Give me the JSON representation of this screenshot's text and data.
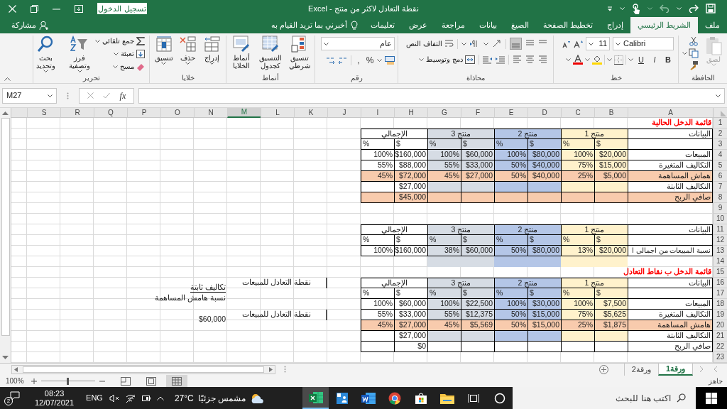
{
  "title_bar": {
    "title": "نقطة التعادل لاكثر من منتج  -  Excel",
    "sign_in": "تسجيل الدخول"
  },
  "ribbon_tabs": [
    {
      "label": "ملف",
      "selected": false
    },
    {
      "label": "الشريط الرئيسي",
      "selected": true
    },
    {
      "label": "إدراج",
      "selected": false
    },
    {
      "label": "تخطيط الصفحة",
      "selected": false
    },
    {
      "label": "الصيغ",
      "selected": false
    },
    {
      "label": "بيانات",
      "selected": false
    },
    {
      "label": "مراجعة",
      "selected": false
    },
    {
      "label": "عرض",
      "selected": false
    },
    {
      "label": "تعليمات",
      "selected": false
    }
  ],
  "tell_me": "أخبرني بما تريد القيام به",
  "share": "مشاركة",
  "ribbon": {
    "clipboard": {
      "label": "الحافظة",
      "paste": "لصق",
      "paste_disabled": true
    },
    "font": {
      "label": "خط",
      "name": "Calibri",
      "size": "11",
      "styles": [
        "B",
        "I",
        "U"
      ]
    },
    "alignment": {
      "label": "محاذاة",
      "wrap": "التفاف النص",
      "merge": "دمج وتوسيط"
    },
    "number": {
      "label": "رقم",
      "format": "عام",
      "symbols": [
        "%",
        ","
      ]
    },
    "styles": {
      "label": "أنماط",
      "buttons": [
        "تنسيق شرطي",
        "التنسيق كجدول",
        "أنماط الخلايا"
      ]
    },
    "cells": {
      "label": "خلايا",
      "buttons": [
        "إدراج",
        "حذف",
        "تنسيق"
      ]
    },
    "editing": {
      "label": "تحرير",
      "small": [
        "جمع تلقائي",
        "تعبئة",
        "مسح"
      ],
      "large": [
        "فرز وتصفية",
        "بحث وتحديد"
      ]
    }
  },
  "formula_bar": {
    "name_box": "M27",
    "function_label": "fx"
  },
  "columns": [
    {
      "label": "A",
      "selected": false
    },
    {
      "label": "B",
      "selected": false
    },
    {
      "label": "C",
      "selected": false
    },
    {
      "label": "D",
      "selected": false
    },
    {
      "label": "E",
      "selected": false
    },
    {
      "label": "F",
      "selected": false
    },
    {
      "label": "G",
      "selected": false
    },
    {
      "label": "H",
      "selected": false
    },
    {
      "label": "I",
      "selected": false
    },
    {
      "label": "J",
      "selected": false
    },
    {
      "label": "K",
      "selected": false
    },
    {
      "label": "L",
      "selected": false
    },
    {
      "label": "M",
      "selected": true
    },
    {
      "label": "N",
      "selected": false
    },
    {
      "label": "O",
      "selected": false
    },
    {
      "label": "P",
      "selected": false
    },
    {
      "label": "Q",
      "selected": false
    },
    {
      "label": "R",
      "selected": false
    },
    {
      "label": "S",
      "selected": false
    }
  ],
  "row_numbers": [
    "1",
    "2",
    "3",
    "4",
    "5",
    "6",
    "7",
    "8",
    "9",
    "10",
    "11",
    "12",
    "13",
    "14",
    "15",
    "16",
    "17",
    "18",
    "19",
    "20",
    "21",
    "22",
    "23"
  ],
  "tables": [
    {
      "title": "قائمة الدخل الحالية",
      "header_label": "البيانات",
      "groups": [
        {
          "label": "منتج 1",
          "color": "#fff2cc"
        },
        {
          "label": "منتج 2",
          "color": "#b4c6e7"
        },
        {
          "label": "منتج 3",
          "color": "#d6dce4"
        },
        {
          "label": "الإجمالي",
          "color": "#ffffff"
        }
      ],
      "units": [
        "$",
        "%",
        "$",
        "%",
        "$",
        "%",
        "$",
        "%"
      ],
      "rows": [
        {
          "label": "المبيعات",
          "kind": "groups",
          "values": [
            "$20,000",
            "100%",
            "$80,000",
            "100%",
            "$60,000",
            "100%",
            "$160,000",
            "100%"
          ]
        },
        {
          "label": "التكاليف المتغيرة",
          "kind": "groups",
          "values": [
            "$15,000",
            "75%",
            "$40,000",
            "50%",
            "$33,000",
            "55%",
            "$88,000",
            "55%"
          ]
        },
        {
          "label": "هماش المساهمة",
          "kind": "highlight",
          "values": [
            "$5,000",
            "25%",
            "$40,000",
            "50%",
            "$27,000",
            "45%",
            "$72,000",
            "45%"
          ]
        },
        {
          "label": "التكاليف الثابتة",
          "kind": "groups",
          "total": "$27,000"
        },
        {
          "label": "صافي الربح",
          "kind": "highlight",
          "total": "$45,000"
        }
      ]
    },
    {
      "header_label": "البيانات",
      "band": true,
      "groups": [
        {
          "label": "منتج 1",
          "color": "#fff2cc"
        },
        {
          "label": "منتج 2",
          "color": "#b4c6e7"
        },
        {
          "label": "منتج 3",
          "color": "#d6dce4"
        },
        {
          "label": "الإجمالي",
          "color": "#ffffff"
        }
      ],
      "units": [
        "$",
        "%",
        "$",
        "%",
        "$",
        "%",
        "$",
        "%"
      ],
      "rows": [
        {
          "label": "نسبة المبيعات من اجمالي ا",
          "kind": "groups",
          "values": [
            "$20,000",
            "13%",
            "$80,000",
            "50%",
            "$60,000",
            "38%",
            "$160,000",
            "100%"
          ]
        }
      ]
    },
    {
      "title": "قائمة الدخل ب نقاط التعادل",
      "header_label": "البيانات",
      "groups": [
        {
          "label": "منتج 1",
          "color": "#fff2cc"
        },
        {
          "label": "منتج 2",
          "color": "#b4c6e7"
        },
        {
          "label": "منتج 3",
          "color": "#d6dce4"
        },
        {
          "label": "الإجمالي",
          "color": "#ffffff"
        }
      ],
      "units": [
        "$",
        "%",
        "$",
        "%",
        "$",
        "%",
        "$",
        "%"
      ],
      "rows": [
        {
          "label": "المبيعات",
          "kind": "groups",
          "values": [
            "$7,500",
            "100%",
            "$30,000",
            "100%",
            "$22,500",
            "100%",
            "$60,000",
            "100%"
          ]
        },
        {
          "label": "التكاليف المتغيرة",
          "kind": "groups",
          "values": [
            "$5,625",
            "75%",
            "$15,000",
            "50%",
            "$12,375",
            "55%",
            "$33,000",
            "55%"
          ]
        },
        {
          "label": "هامش المساهمة",
          "kind": "highlight",
          "values": [
            "$1,875",
            "25%",
            "$15,000",
            "50%",
            "$5,569",
            "45%",
            "$27,000",
            "45%"
          ]
        },
        {
          "label": "التكاليف الثابتة",
          "kind": "groups",
          "total": "$27,000"
        },
        {
          "label": "صافي الربح",
          "kind": "plain",
          "total": "$0"
        }
      ],
      "notes": [
        {
          "label": "نقطة التعادل للمبيعات",
          "value": "تكاليف ثابتة",
          "sub": "نسبة هامش المساهمة"
        },
        {
          "label": "نقطة التعادل للمبيعات",
          "value": "$60,000"
        }
      ]
    }
  ],
  "sheets": [
    {
      "label": "ورقة1",
      "selected": true
    },
    {
      "label": "ورقة2",
      "selected": false
    }
  ],
  "status": "جاهز",
  "zoom": {
    "label": "100%",
    "level": 0.5
  },
  "views": [
    {
      "kind": "normal",
      "selected": true
    },
    {
      "kind": "page_layout",
      "selected": false
    },
    {
      "kind": "page_break",
      "selected": false
    }
  ],
  "taskbar": {
    "search_placeholder": "اكتب هنا للبحث",
    "apps": [
      {
        "kind": "cortana",
        "active": false
      },
      {
        "kind": "task_view",
        "active": false
      },
      {
        "kind": "explorer",
        "active": false
      },
      {
        "kind": "store",
        "active": false
      },
      {
        "kind": "chrome",
        "active": false
      },
      {
        "kind": "word",
        "active": false
      },
      {
        "kind": "people",
        "active": false
      },
      {
        "kind": "excel",
        "active": true
      }
    ],
    "weather": {
      "text": "مشمس جزئيًا",
      "temp": "27°C"
    },
    "language": "ENG",
    "time": "08:23",
    "date": "12/07/2021",
    "notifications": "2"
  }
}
